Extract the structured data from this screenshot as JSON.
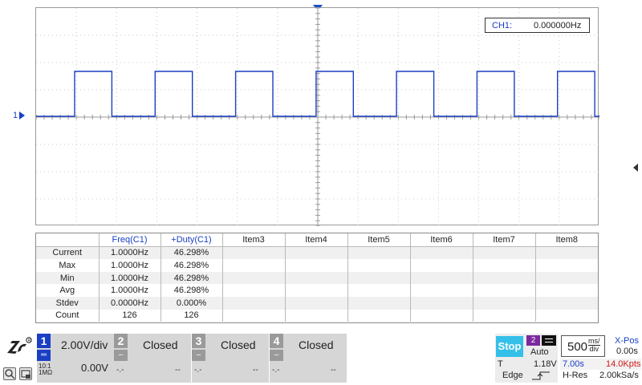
{
  "scope": {
    "frequency_readout": {
      "label": "CH1:",
      "value": "0.000000Hz"
    },
    "channel_marker": "1",
    "waveform_color": "#1a3fc4"
  },
  "measurements": {
    "headers": [
      "",
      "Freq(C1)",
      "+Duty(C1)",
      "Item3",
      "Item4",
      "Item5",
      "Item6",
      "Item7",
      "Item8"
    ],
    "rows": [
      {
        "label": "Current",
        "freq": "1.0000Hz",
        "duty": "46.298%"
      },
      {
        "label": "Max",
        "freq": "1.0000Hz",
        "duty": "46.298%"
      },
      {
        "label": "Min",
        "freq": "1.0000Hz",
        "duty": "46.298%"
      },
      {
        "label": "Avg",
        "freq": "1.0000Hz",
        "duty": "46.298%"
      },
      {
        "label": "Stdev",
        "freq": "0.0000Hz",
        "duty": "0.000%"
      },
      {
        "label": "Count",
        "freq": "126",
        "duty": "126"
      }
    ]
  },
  "channels": [
    {
      "num": "1",
      "scale": "2.00V/div",
      "offset": "0.00V",
      "coupling_note_1": "10:1",
      "coupling_note_2": "1MΩ"
    },
    {
      "num": "2",
      "status": "Closed",
      "dash_left": "-.-",
      "dash_right": "--"
    },
    {
      "num": "3",
      "status": "Closed",
      "dash_left": "-.-",
      "dash_right": "--"
    },
    {
      "num": "4",
      "status": "Closed",
      "dash_left": "-.-",
      "dash_right": "--"
    }
  ],
  "trigger": {
    "run_state": "Stop",
    "source": "2",
    "mode": "Auto",
    "t_label": "T",
    "level": "1.18V",
    "type": "Edge"
  },
  "timebase": {
    "scale": "500",
    "unit_top": "ms/",
    "unit_bottom": "div",
    "xpos_label": "X-Pos",
    "xpos_value": "0.00s",
    "time_window": "7.00s",
    "points": "14.0Kpts",
    "acq_mode": "H-Res",
    "sample_rate": "2.00kSa/s"
  }
}
